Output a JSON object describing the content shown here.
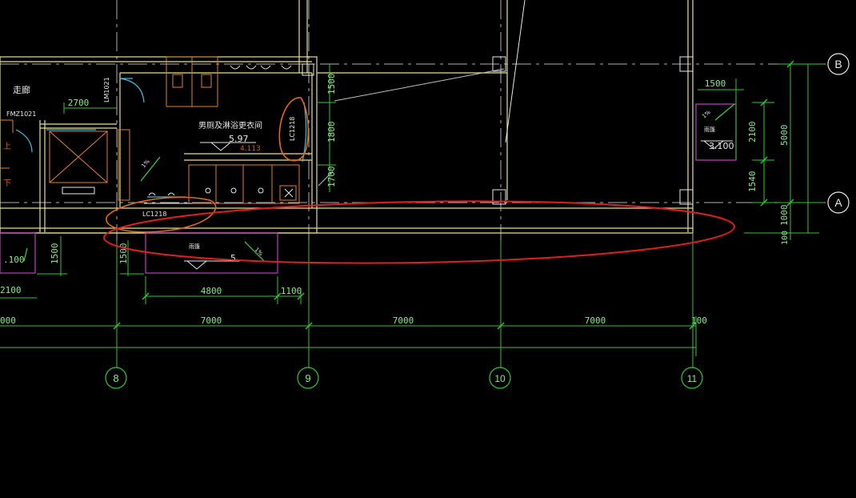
{
  "axes": {
    "horizontal": [
      {
        "label": "B"
      },
      {
        "label": "A"
      }
    ],
    "vertical": [
      {
        "label": "8"
      },
      {
        "label": "9"
      },
      {
        "label": "10"
      },
      {
        "label": "11"
      }
    ]
  },
  "dimensions": {
    "bottom_spans": [
      "000",
      "7000",
      "7000",
      "7000",
      "100"
    ],
    "sub_spans": [
      "4800",
      "1100"
    ],
    "left_small": [
      "1500",
      "1500"
    ],
    "right_vertical": [
      "1500",
      "2100",
      "1540",
      "5000",
      "1000",
      "100"
    ],
    "room_widths": [
      "2700"
    ],
    "col9_vertical": [
      "1500",
      "1800",
      "1700"
    ],
    "left_edge_vals": [
      ".100",
      "2100"
    ]
  },
  "rooms": {
    "corridor": "走廊",
    "door_fm": "FMZ1021",
    "door_lm": "LM1021",
    "restroom": "男厕及淋浴更衣间",
    "up_symbol": "上",
    "down_symbol": "下",
    "ramp_label": "雨篷",
    "ramp_label_right": "雨篷"
  },
  "elevations": {
    "restroom": "5.97",
    "restroom_sub": "4.113",
    "right_box": "3.100",
    "canopy": "5"
  },
  "annotations": {
    "lc_label": "LC1218",
    "lc_label_side": "LC1218",
    "slope_1": "1%",
    "slope_2": "1%",
    "slope_3": "1%"
  },
  "colors": {
    "background": "#000000",
    "dim_green": "#32C832",
    "wall_yellow": "#E8E08C",
    "wall_white": "#E8E8E8",
    "magenta": "#C040C0",
    "orange": "#E06A1A",
    "red_markup": "#E02020",
    "cyan": "#40C0E0"
  }
}
